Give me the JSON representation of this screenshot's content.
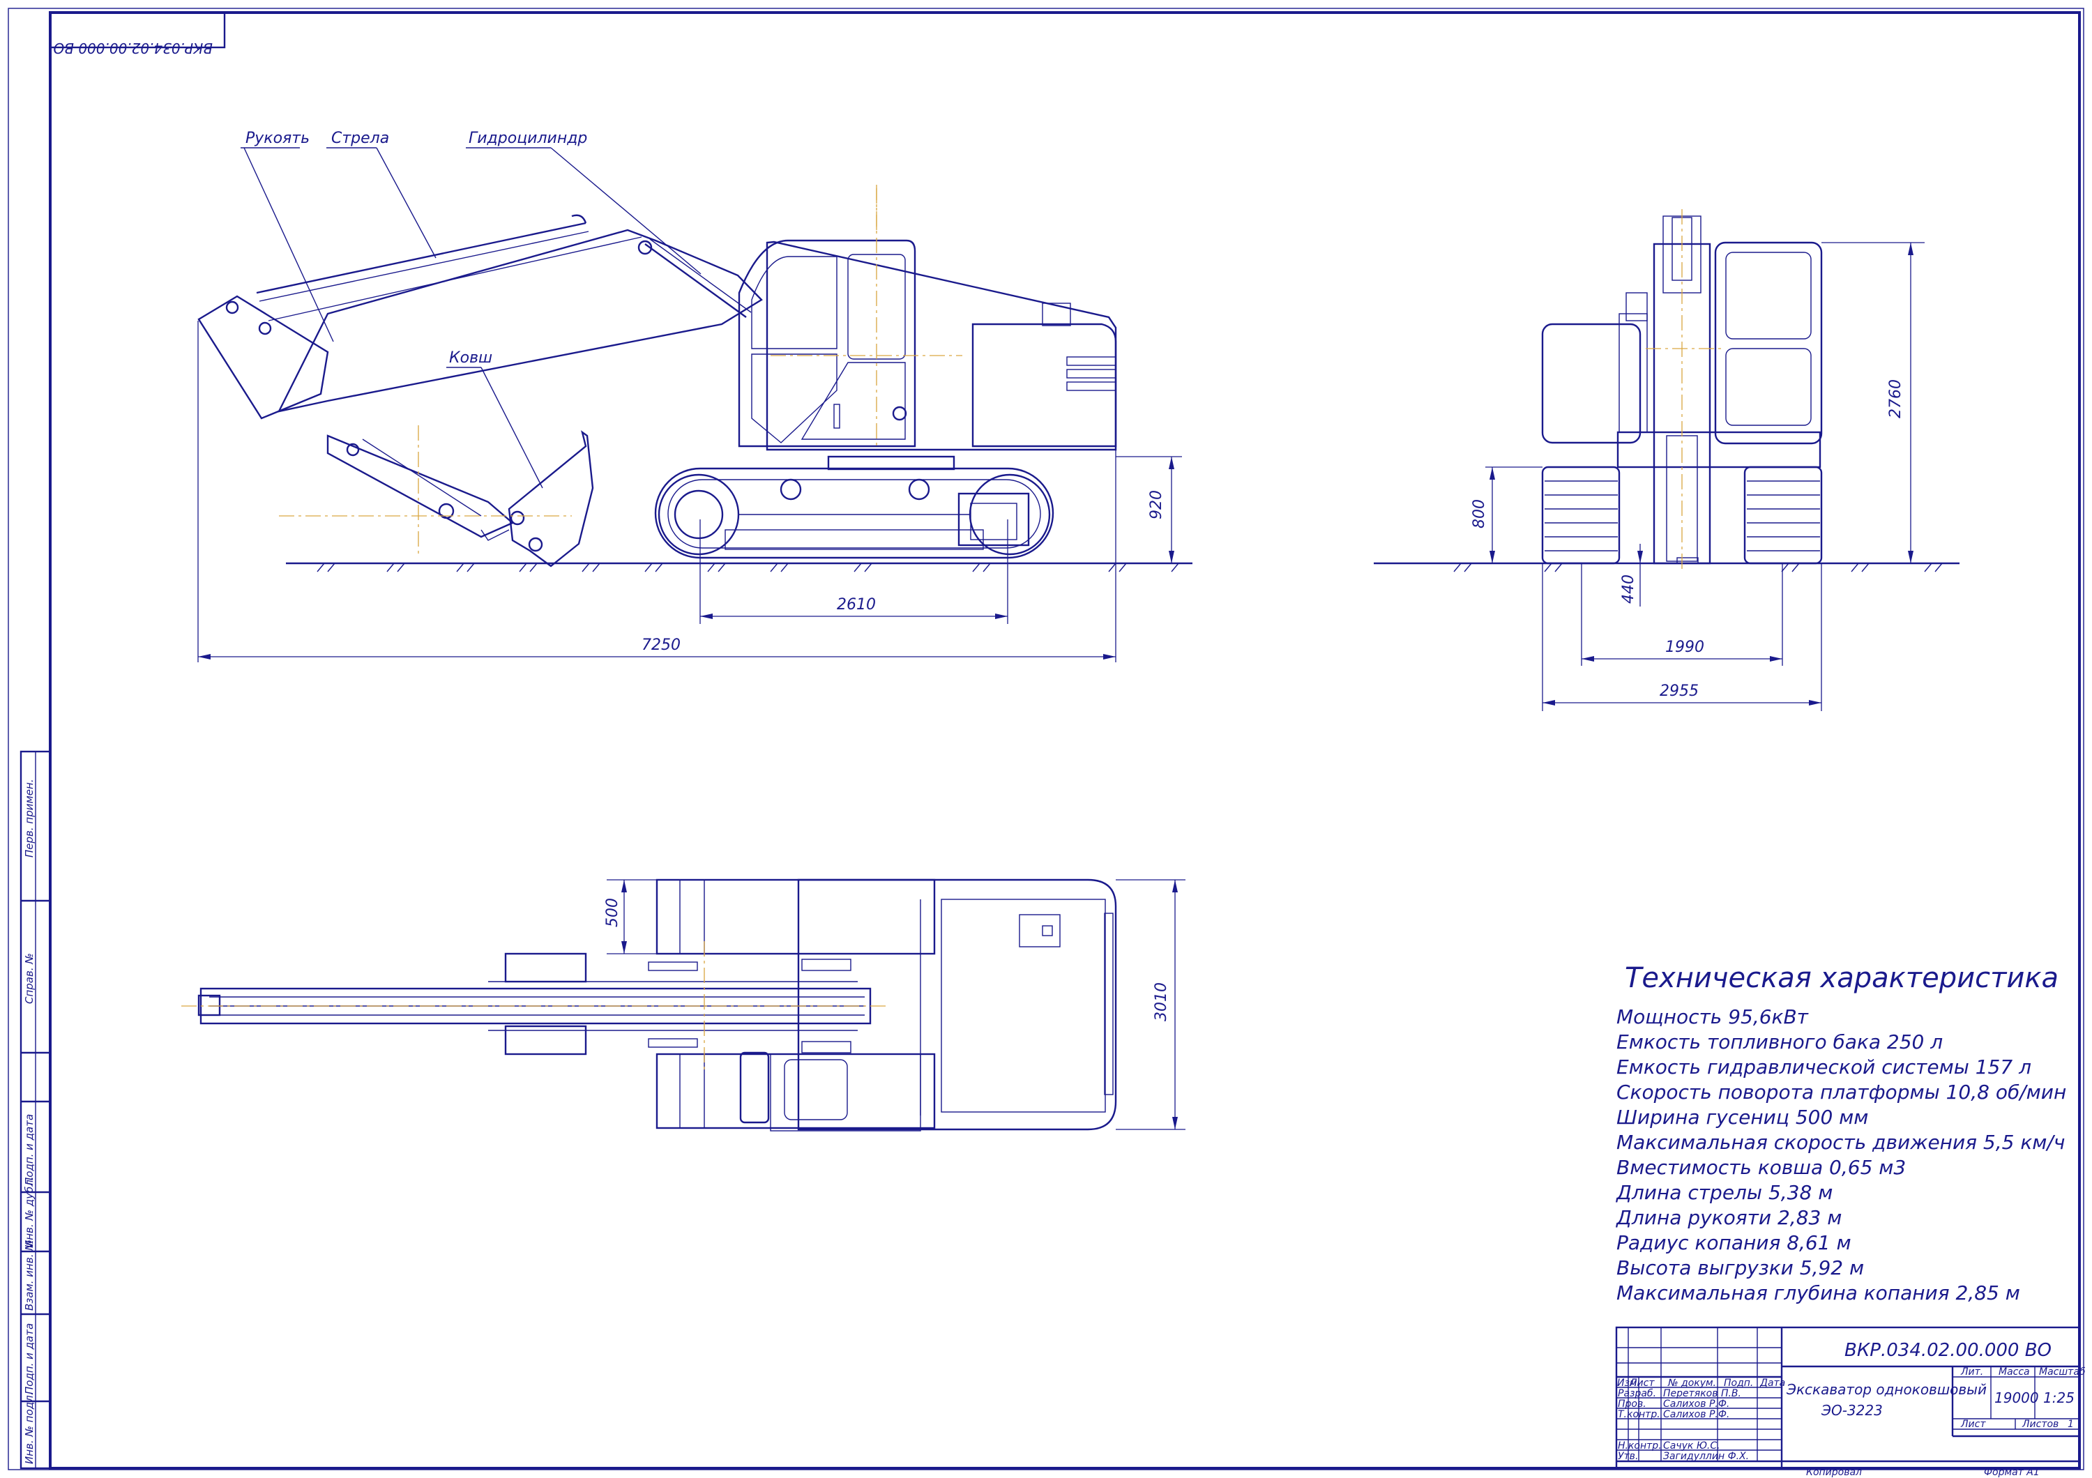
{
  "sheet": {
    "designation_stamp": "ВКР.034.02.00.000 ВО"
  },
  "side_view": {
    "labels": {
      "arm": "Рукоять",
      "boom": "Стрела",
      "cylinder": "Гидроцилиндр",
      "bucket": "Ковш"
    },
    "dims": {
      "overall_length": "7250",
      "track_base": "2610",
      "clearance_height": "920"
    }
  },
  "front_view": {
    "dims": {
      "overall_height": "2760",
      "track_height": "800",
      "ground_clearance": "440",
      "track_gauge": "1990",
      "overall_width": "2955"
    }
  },
  "top_view": {
    "dims": {
      "track_width": "500",
      "overall_width": "3010"
    }
  },
  "specs": {
    "title": "Техническая характеристика",
    "lines": [
      "Мощность  95,6кВт",
      "Емкость топливного бака    250 л",
      "Емкость гидравлической системы 157 л",
      "Скорость поворота платформы    10,8 об/мин",
      "Ширина гусениц  500 мм",
      "Максимальная скорость движения 5,5 км/ч",
      "Вместимость ковша    0,65 м3",
      "Длина стрелы      5,38 м",
      "Длина рукояти      2,83 м",
      "Радиус копания    8,61 м",
      "Высота выгрузки    5,92 м",
      "Максимальная глубина копания      2,85 м"
    ]
  },
  "title_block": {
    "designation": "ВКР.034.02.00.000 ВО",
    "name_line1": "Экскаватор одноковшовый",
    "name_line2": "ЭО-3223",
    "col_headers": {
      "izm": "Изм.",
      "list": "Лист",
      "doc": "№ докум.",
      "sign": "Подп.",
      "date": "Дата"
    },
    "roles": {
      "razrab": "Разраб.",
      "prov": "Пров.",
      "tkontr": "Т.контр.",
      "nkontr": "Н.контр.",
      "utv": "Утв."
    },
    "names": {
      "razrab": "Перетяков П.В.",
      "prov": "Салихов Р.Ф.",
      "tkontr": "Салихов Р.Ф.",
      "nkontr": "Сачук Ю.С.",
      "utv": "Загидуллин Ф.Х."
    },
    "lit_label": "Лит.",
    "mass_label": "Масса",
    "scale_label": "Масштаб",
    "mass": "19000",
    "scale": "1:25",
    "sheet_label": "Лист",
    "sheets_label": "Листов",
    "sheets": "1",
    "copied": "Копировал",
    "format": "Формат     А1"
  },
  "side_stamp": {
    "perv_primen": "Перв. примен.",
    "sprav": "Справ. №",
    "podp_data_1": "Подп. и дата",
    "inv_dubl": "Инв. № дубл.",
    "vzam_inv": "Взам. инв. №",
    "podp_data_2": "Подп. и дата",
    "inv_podl": "Инв. № подл."
  }
}
